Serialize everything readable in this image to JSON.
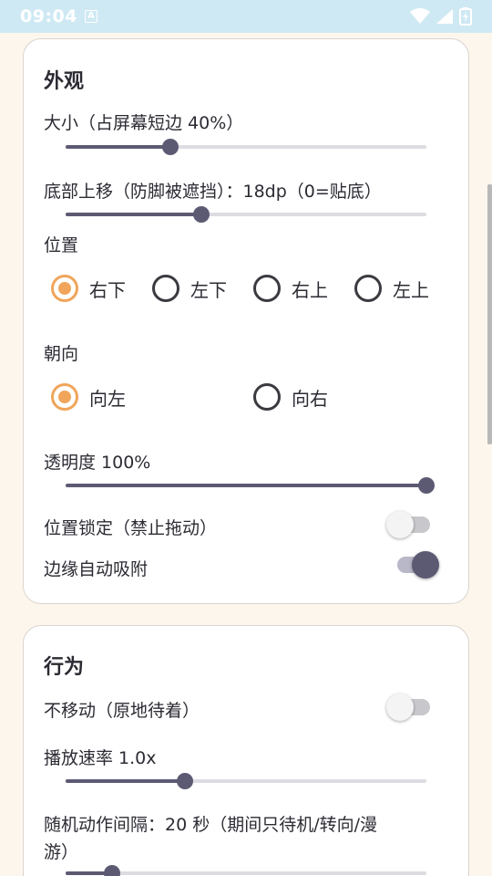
{
  "status_bar": {
    "time": "09:04",
    "badge": "A",
    "icons": [
      "wifi-icon",
      "signal-icon",
      "battery-charging-icon"
    ]
  },
  "appearance": {
    "title": "外观",
    "size": {
      "label": "大小（占屏幕短边 40%）",
      "value_fraction": 0.29
    },
    "bottom_offset": {
      "label": "底部上移（防脚被遮挡）：18dp（0=贴底）",
      "value_fraction": 0.375
    },
    "position": {
      "label": "位置",
      "options": [
        "右下",
        "左下",
        "右上",
        "左上"
      ],
      "selected": "右下"
    },
    "facing": {
      "label": "朝向",
      "options": [
        "向左",
        "向右"
      ],
      "selected": "向左"
    },
    "opacity": {
      "label": "透明度 100%",
      "value_fraction": 1.0
    },
    "lock_position": {
      "label": "位置锁定（禁止拖动）",
      "on": false
    },
    "edge_snap": {
      "label": "边缘自动吸附",
      "on": true
    }
  },
  "behavior": {
    "title": "行为",
    "no_move": {
      "label": "不移动（原地待着）",
      "on": false
    },
    "playback_rate": {
      "label": "播放速率 1.0x",
      "value_fraction": 0.33
    },
    "random_interval": {
      "label_line1": "随机动作间隔：20 秒（期间只待机/转向/漫",
      "label_line2": "游）",
      "value_fraction": 0.13
    }
  },
  "colors": {
    "accent_orange": "#f0a55a",
    "slider_dark": "#5c5a73",
    "background": "#fdf6ec",
    "status_bar": "#cfe9f4"
  }
}
